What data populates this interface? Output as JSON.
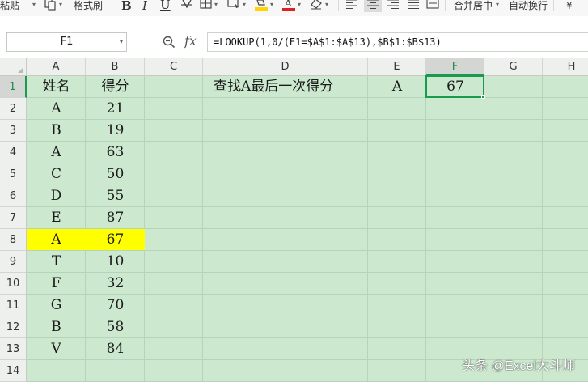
{
  "toolbar": {
    "paste_label": "粘贴",
    "format_painter_label": "格式刷",
    "bold_label": "B",
    "italic_label": "I",
    "underline_label": "U",
    "merge_center_label": "合并居中",
    "wrap_text_label": "自动换行",
    "overflow_label": "¥"
  },
  "formula_bar": {
    "name_box": "F1",
    "fx_label": "fx",
    "formula": "=LOOKUP(1,0/(E1=$A$1:$A$13),$B$1:$B$13)"
  },
  "sheet": {
    "columns": [
      "A",
      "B",
      "C",
      "D",
      "E",
      "F",
      "G",
      "H"
    ],
    "active_column": "F",
    "active_row": 1,
    "rows": [
      {
        "num": "1",
        "a": "姓名",
        "b": "得分",
        "d": "查找A最后一次得分",
        "e": "A",
        "f": "67"
      },
      {
        "num": "2",
        "a": "A",
        "b": "21"
      },
      {
        "num": "3",
        "a": "B",
        "b": "19"
      },
      {
        "num": "4",
        "a": "A",
        "b": "63"
      },
      {
        "num": "5",
        "a": "C",
        "b": "50"
      },
      {
        "num": "6",
        "a": "D",
        "b": "55"
      },
      {
        "num": "7",
        "a": "E",
        "b": "87"
      },
      {
        "num": "8",
        "a": "A",
        "b": "67"
      },
      {
        "num": "9",
        "a": "T",
        "b": "10"
      },
      {
        "num": "10",
        "a": "F",
        "b": "32"
      },
      {
        "num": "11",
        "a": "G",
        "b": "70"
      },
      {
        "num": "12",
        "a": "B",
        "b": "58"
      },
      {
        "num": "13",
        "a": "V",
        "b": "84"
      },
      {
        "num": "14"
      }
    ],
    "highlighted_row": 8,
    "highlight_color": "#ffff00",
    "cell_background": "#cce8cf",
    "selection_color": "#1a9a4f"
  },
  "watermark": "头条 @Excel大斗师"
}
